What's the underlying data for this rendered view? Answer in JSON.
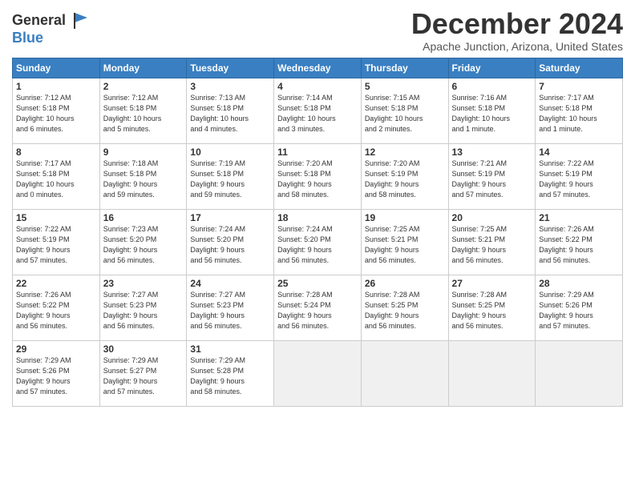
{
  "logo": {
    "general": "General",
    "blue": "Blue"
  },
  "title": "December 2024",
  "location": "Apache Junction, Arizona, United States",
  "days_of_week": [
    "Sunday",
    "Monday",
    "Tuesday",
    "Wednesday",
    "Thursday",
    "Friday",
    "Saturday"
  ],
  "weeks": [
    [
      {
        "day": "1",
        "info": "Sunrise: 7:12 AM\nSunset: 5:18 PM\nDaylight: 10 hours\nand 6 minutes."
      },
      {
        "day": "2",
        "info": "Sunrise: 7:12 AM\nSunset: 5:18 PM\nDaylight: 10 hours\nand 5 minutes."
      },
      {
        "day": "3",
        "info": "Sunrise: 7:13 AM\nSunset: 5:18 PM\nDaylight: 10 hours\nand 4 minutes."
      },
      {
        "day": "4",
        "info": "Sunrise: 7:14 AM\nSunset: 5:18 PM\nDaylight: 10 hours\nand 3 minutes."
      },
      {
        "day": "5",
        "info": "Sunrise: 7:15 AM\nSunset: 5:18 PM\nDaylight: 10 hours\nand 2 minutes."
      },
      {
        "day": "6",
        "info": "Sunrise: 7:16 AM\nSunset: 5:18 PM\nDaylight: 10 hours\nand 1 minute."
      },
      {
        "day": "7",
        "info": "Sunrise: 7:17 AM\nSunset: 5:18 PM\nDaylight: 10 hours\nand 1 minute."
      }
    ],
    [
      {
        "day": "8",
        "info": "Sunrise: 7:17 AM\nSunset: 5:18 PM\nDaylight: 10 hours\nand 0 minutes."
      },
      {
        "day": "9",
        "info": "Sunrise: 7:18 AM\nSunset: 5:18 PM\nDaylight: 9 hours\nand 59 minutes."
      },
      {
        "day": "10",
        "info": "Sunrise: 7:19 AM\nSunset: 5:18 PM\nDaylight: 9 hours\nand 59 minutes."
      },
      {
        "day": "11",
        "info": "Sunrise: 7:20 AM\nSunset: 5:18 PM\nDaylight: 9 hours\nand 58 minutes."
      },
      {
        "day": "12",
        "info": "Sunrise: 7:20 AM\nSunset: 5:19 PM\nDaylight: 9 hours\nand 58 minutes."
      },
      {
        "day": "13",
        "info": "Sunrise: 7:21 AM\nSunset: 5:19 PM\nDaylight: 9 hours\nand 57 minutes."
      },
      {
        "day": "14",
        "info": "Sunrise: 7:22 AM\nSunset: 5:19 PM\nDaylight: 9 hours\nand 57 minutes."
      }
    ],
    [
      {
        "day": "15",
        "info": "Sunrise: 7:22 AM\nSunset: 5:19 PM\nDaylight: 9 hours\nand 57 minutes."
      },
      {
        "day": "16",
        "info": "Sunrise: 7:23 AM\nSunset: 5:20 PM\nDaylight: 9 hours\nand 56 minutes."
      },
      {
        "day": "17",
        "info": "Sunrise: 7:24 AM\nSunset: 5:20 PM\nDaylight: 9 hours\nand 56 minutes."
      },
      {
        "day": "18",
        "info": "Sunrise: 7:24 AM\nSunset: 5:20 PM\nDaylight: 9 hours\nand 56 minutes."
      },
      {
        "day": "19",
        "info": "Sunrise: 7:25 AM\nSunset: 5:21 PM\nDaylight: 9 hours\nand 56 minutes."
      },
      {
        "day": "20",
        "info": "Sunrise: 7:25 AM\nSunset: 5:21 PM\nDaylight: 9 hours\nand 56 minutes."
      },
      {
        "day": "21",
        "info": "Sunrise: 7:26 AM\nSunset: 5:22 PM\nDaylight: 9 hours\nand 56 minutes."
      }
    ],
    [
      {
        "day": "22",
        "info": "Sunrise: 7:26 AM\nSunset: 5:22 PM\nDaylight: 9 hours\nand 56 minutes."
      },
      {
        "day": "23",
        "info": "Sunrise: 7:27 AM\nSunset: 5:23 PM\nDaylight: 9 hours\nand 56 minutes."
      },
      {
        "day": "24",
        "info": "Sunrise: 7:27 AM\nSunset: 5:23 PM\nDaylight: 9 hours\nand 56 minutes."
      },
      {
        "day": "25",
        "info": "Sunrise: 7:28 AM\nSunset: 5:24 PM\nDaylight: 9 hours\nand 56 minutes."
      },
      {
        "day": "26",
        "info": "Sunrise: 7:28 AM\nSunset: 5:25 PM\nDaylight: 9 hours\nand 56 minutes."
      },
      {
        "day": "27",
        "info": "Sunrise: 7:28 AM\nSunset: 5:25 PM\nDaylight: 9 hours\nand 56 minutes."
      },
      {
        "day": "28",
        "info": "Sunrise: 7:29 AM\nSunset: 5:26 PM\nDaylight: 9 hours\nand 57 minutes."
      }
    ],
    [
      {
        "day": "29",
        "info": "Sunrise: 7:29 AM\nSunset: 5:26 PM\nDaylight: 9 hours\nand 57 minutes."
      },
      {
        "day": "30",
        "info": "Sunrise: 7:29 AM\nSunset: 5:27 PM\nDaylight: 9 hours\nand 57 minutes."
      },
      {
        "day": "31",
        "info": "Sunrise: 7:29 AM\nSunset: 5:28 PM\nDaylight: 9 hours\nand 58 minutes."
      },
      {
        "day": "",
        "info": ""
      },
      {
        "day": "",
        "info": ""
      },
      {
        "day": "",
        "info": ""
      },
      {
        "day": "",
        "info": ""
      }
    ]
  ]
}
